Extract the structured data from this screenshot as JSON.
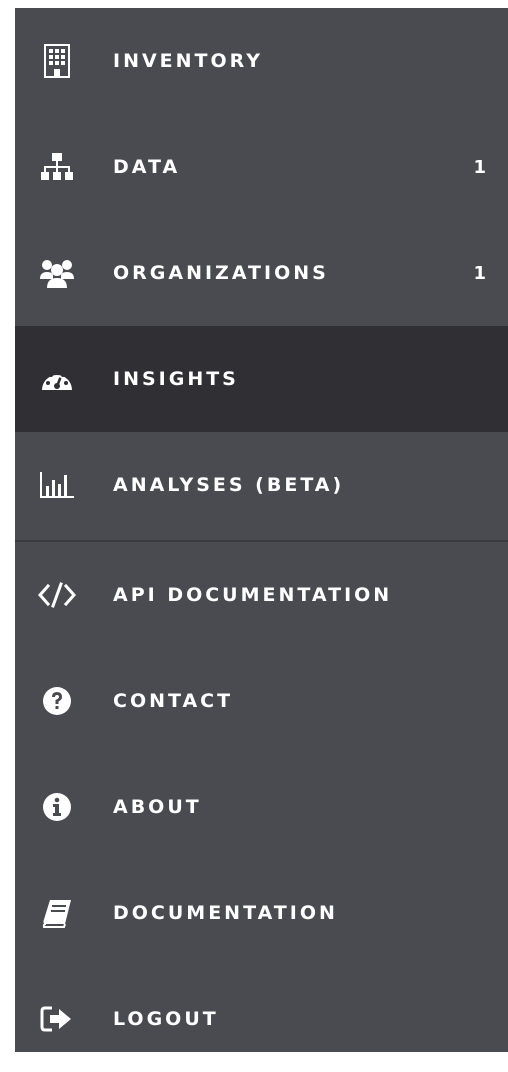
{
  "nav": {
    "items": [
      {
        "label": "INVENTORY",
        "icon": "building-icon",
        "count": ""
      },
      {
        "label": "DATA",
        "icon": "sitemap-icon",
        "count": "1"
      },
      {
        "label": "ORGANIZATIONS",
        "icon": "users-icon",
        "count": "1"
      },
      {
        "label": "INSIGHTS",
        "icon": "dashboard-gauge-icon",
        "count": "",
        "active": true
      },
      {
        "label": "ANALYSES (BETA)",
        "icon": "bar-chart-icon",
        "count": ""
      },
      {
        "label": "API DOCUMENTATION",
        "icon": "code-icon",
        "count": ""
      },
      {
        "label": "CONTACT",
        "icon": "question-circle-icon",
        "count": ""
      },
      {
        "label": "ABOUT",
        "icon": "info-circle-icon",
        "count": ""
      },
      {
        "label": "DOCUMENTATION",
        "icon": "book-icon",
        "count": ""
      },
      {
        "label": "LOGOUT",
        "icon": "sign-out-icon",
        "count": ""
      }
    ]
  },
  "colors": {
    "sidebar_bg": "#4a4a51",
    "active_bg": "#2f2f34",
    "text": "#ffffff"
  }
}
